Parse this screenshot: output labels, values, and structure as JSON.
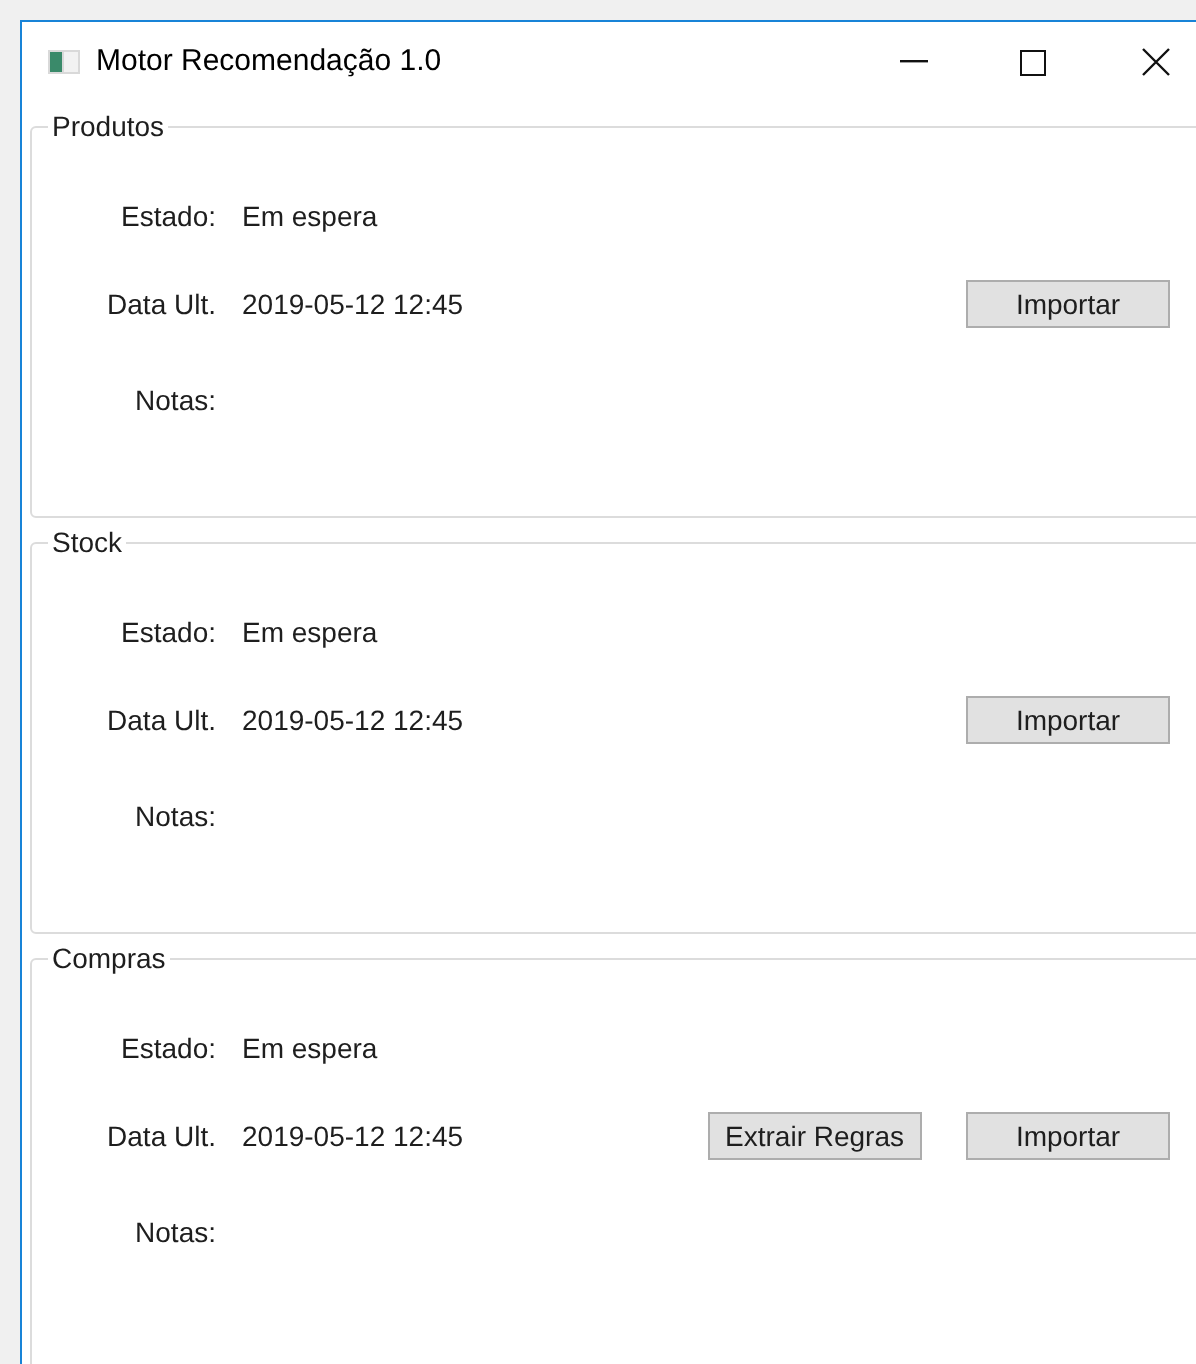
{
  "window": {
    "title": "Motor Recomendação 1.0"
  },
  "groups": [
    {
      "title": "Produtos",
      "fields": [
        {
          "label": "Estado:",
          "value": "Em espera"
        },
        {
          "label": "Data Ult.",
          "value": "2019-05-12 12:45"
        },
        {
          "label": "Notas:"
        }
      ],
      "buttons": [
        "Importar"
      ]
    },
    {
      "title": "Stock",
      "fields": [
        {
          "label": "Estado:",
          "value": "Em espera"
        },
        {
          "label": "Data Ult.",
          "value": "2019-05-12 12:45"
        },
        {
          "label": "Notas:"
        }
      ],
      "buttons": [
        "Importar"
      ]
    },
    {
      "title": "Compras",
      "fields": [
        {
          "label": "Estado:",
          "value": "Em espera"
        },
        {
          "label": "Data Ult.",
          "value": "2019-05-12 12:45"
        },
        {
          "label": "Notas:"
        }
      ],
      "buttons": [
        "Extrair Regras",
        "Importar"
      ]
    }
  ]
}
